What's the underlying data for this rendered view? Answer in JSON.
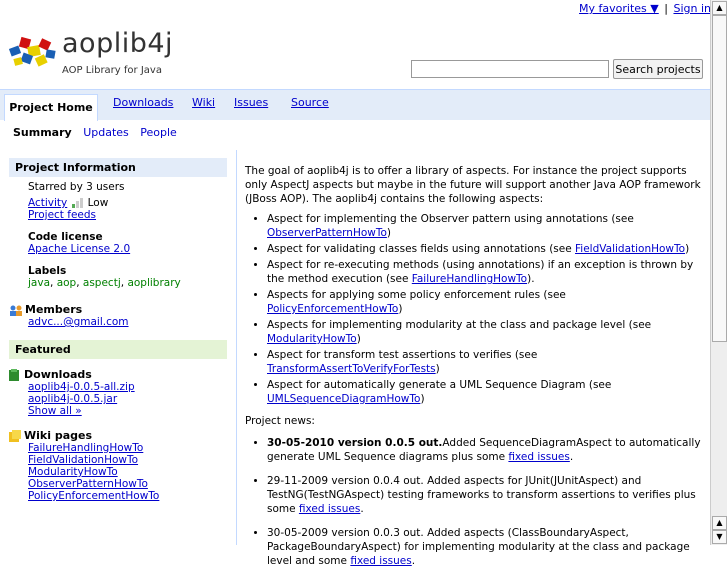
{
  "topbar": {
    "favorites": "My favorites ▼",
    "sep": "|",
    "signin": "Sign in"
  },
  "header": {
    "title": "aoplib4j",
    "subtitle": "AOP Library for Java"
  },
  "search": {
    "button": "Search projects",
    "placeholder": ""
  },
  "tabs": [
    {
      "label": "Project Home",
      "active": true
    },
    {
      "label": "Downloads"
    },
    {
      "label": "Wiki"
    },
    {
      "label": "Issues"
    },
    {
      "label": "Source"
    }
  ],
  "subtabs": {
    "summary": "Summary",
    "updates": "Updates",
    "people": "People"
  },
  "sidebar": {
    "info_head": "Project Information",
    "starred": "Starred by 3 users",
    "activity": "Activity",
    "activity_level": "Low",
    "feeds": "Project feeds",
    "license_label": "Code license",
    "license": "Apache License 2.0",
    "labels_label": "Labels",
    "labels": [
      "java",
      "aop",
      "aspectj",
      "aoplibrary"
    ],
    "members_label": "Members",
    "member": "advc...@gmail.com",
    "featured_head": "Featured",
    "downloads_label": "Downloads",
    "downloads": [
      "aoplib4j-0.0.5-all.zip",
      "aoplib4j-0.0.5.jar"
    ],
    "show_all": "Show all »",
    "wiki_label": "Wiki pages",
    "wiki": [
      "FailureHandlingHowTo",
      "FieldValidationHowTo",
      "ModularityHowTo",
      "ObserverPatternHowTo",
      "PolicyEnforcementHowTo"
    ]
  },
  "main": {
    "intro": "The goal of aoplib4j is to offer a library of aspects. For instance the project supports only AspectJ aspects but maybe in the future will support another Java AOP framework (JBoss AOP). The aoplib4j contains the following aspects:",
    "aspects": [
      {
        "text": "Aspect for implementing the Observer pattern using annotations (see ",
        "link": "ObserverPatternHowTo",
        "end": ")"
      },
      {
        "text": "Aspect for validating classes fields using annotations (see ",
        "link": "FieldValidationHowTo",
        "end": ")"
      },
      {
        "text": "Aspect for re-executing methods (using annotations) if an exception is thrown by the method execution (see ",
        "link": "FailureHandlingHowTo",
        "end": ")."
      },
      {
        "text": "Aspects for applying some policy enforcement rules (see ",
        "link": "PolicyEnforcementHowTo",
        "end": ")"
      },
      {
        "text": "Aspects for implementing modularity at the class and package level (see ",
        "link": "ModularityHowTo",
        "end": ")"
      },
      {
        "text": "Aspect for transform test assertions to verifies (see ",
        "link": "TransformAssertToVerifyForTests",
        "end": ")"
      },
      {
        "text": "Aspect for automatically generate a UML Sequence Diagram (see ",
        "link": "UMLSequenceDiagramHowTo",
        "end": ")"
      }
    ],
    "news_label": "Project news:",
    "news": [
      {
        "bold": "30-05-2010 version 0.0.5 out.",
        "text": "Added SequenceDiagramAspect to automatically generate UML Sequence diagrams plus some ",
        "link": "fixed issues",
        "end": "."
      },
      {
        "bold": "",
        "text": "29-11-2009 version 0.0.4 out. Added aspects for JUnit(JUnitAspect) and TestNG(TestNGAspect) testing frameworks to transform assertions to verifies plus some ",
        "link": "fixed issues",
        "end": "."
      },
      {
        "bold": "",
        "text": "30-05-2009 version 0.0.3 out. Added aspects (ClassBoundaryAspect, PackageBoundaryAspect) for implementing modularity at the class and package level and some ",
        "link": "fixed issues",
        "end": "."
      }
    ]
  }
}
